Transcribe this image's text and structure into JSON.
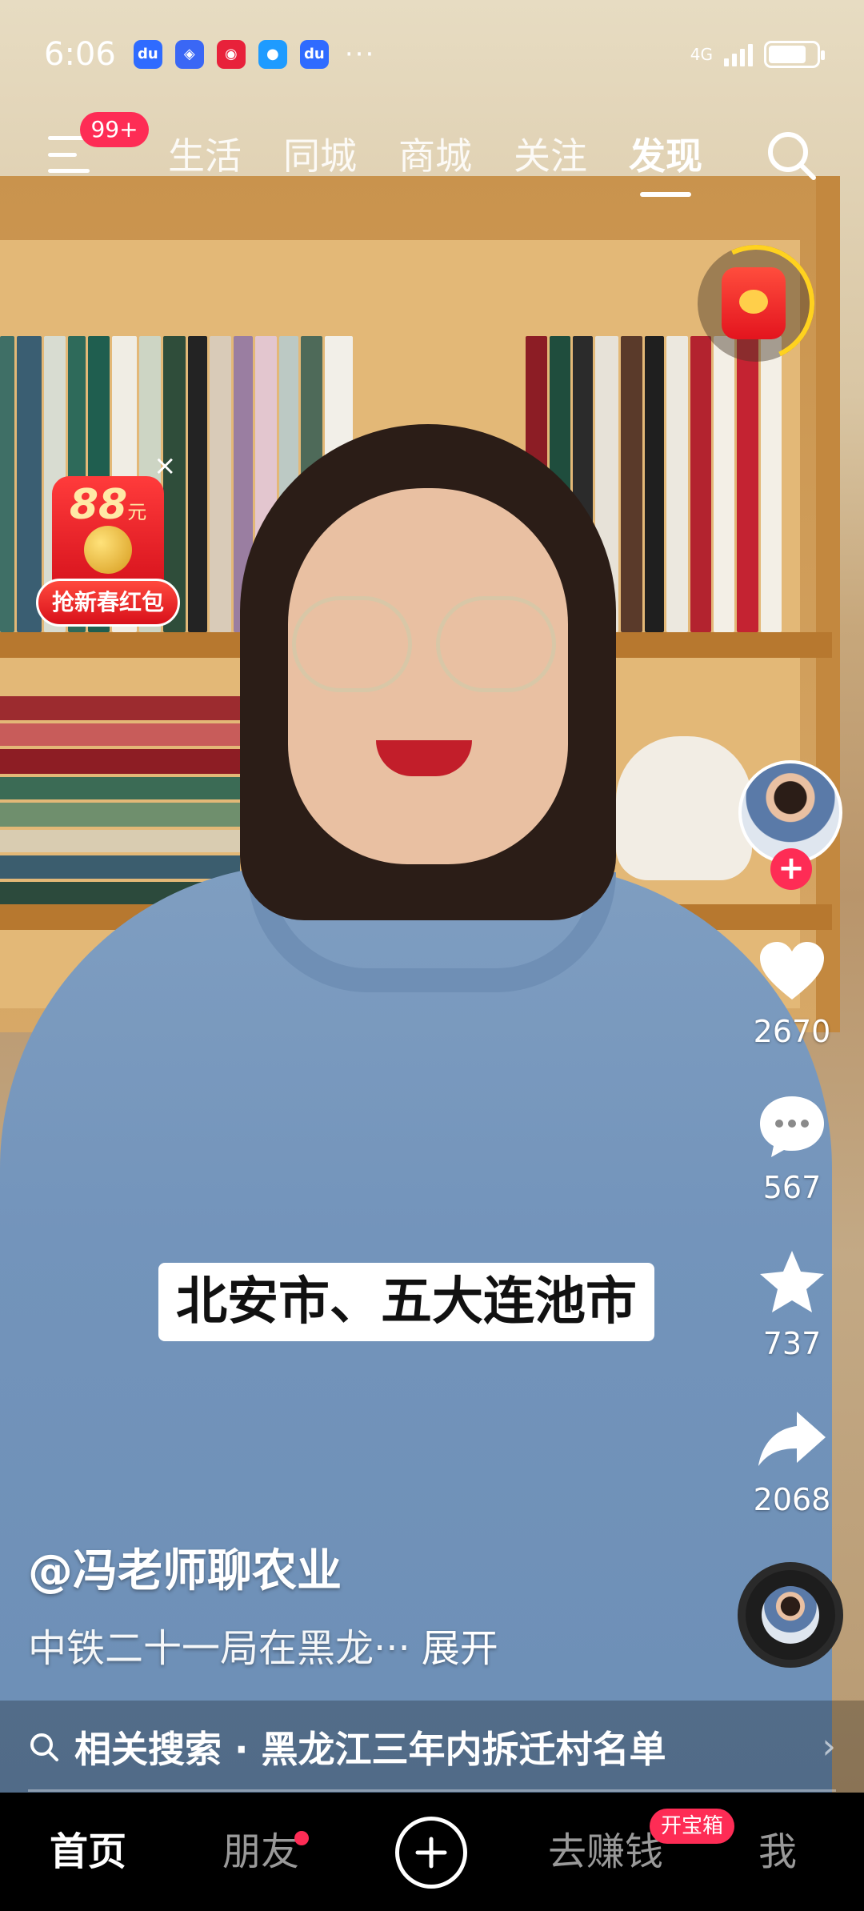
{
  "status_bar": {
    "time": "6:06",
    "app_icons": [
      {
        "icon": "baidu-icon",
        "color": "#2f6bff"
      },
      {
        "icon": "shield-app-icon",
        "color": "#3a67f5"
      },
      {
        "icon": "red-packet-app-icon",
        "color": "#e8213a"
      },
      {
        "icon": "message-app-icon",
        "color": "#1e9bff"
      },
      {
        "icon": "baidu-icon",
        "color": "#2f6bff"
      }
    ],
    "more": "···",
    "network": "4G",
    "battery_level": 0.8
  },
  "top_nav": {
    "menu_badge": "99+",
    "tabs": [
      {
        "label": "生活",
        "active": false
      },
      {
        "label": "同城",
        "active": false
      },
      {
        "label": "商城",
        "active": false
      },
      {
        "label": "关注",
        "active": false
      },
      {
        "label": "发现",
        "active": true
      }
    ],
    "search_icon": "search-icon"
  },
  "red_packet": {
    "amount": "88",
    "unit": "元",
    "label": "抢新春红包",
    "close": "×"
  },
  "video": {
    "caption": "北安市、五大连池市"
  },
  "side_rail": {
    "follow": "+",
    "like_count": "2670",
    "comment_count": "567",
    "favorite_count": "737",
    "share_count": "2068"
  },
  "post": {
    "author": "@冯老师聊农业",
    "description": "中铁二十一局在黑龙···",
    "expand": "展开"
  },
  "related_search": {
    "text": "相关搜索 · 黑龙江三年内拆迁村名单",
    "arrow": "›"
  },
  "bottom_bar": {
    "home": "首页",
    "friends": "朋友",
    "earn": "去赚钱",
    "treasure_badge": "开宝箱",
    "me": "我"
  },
  "colors": {
    "accent": "#fe2c55",
    "background": "#000000"
  }
}
